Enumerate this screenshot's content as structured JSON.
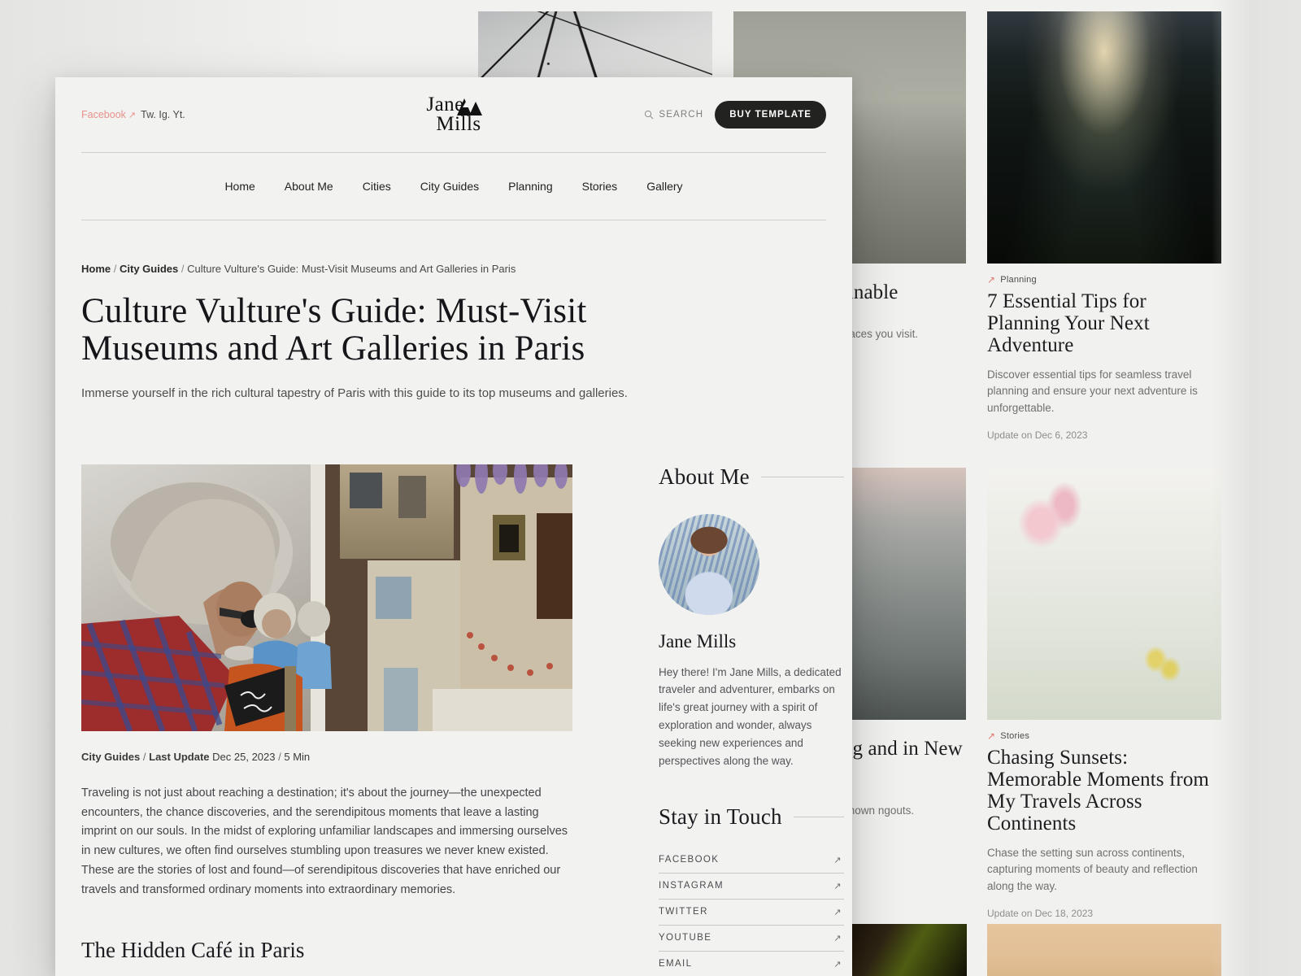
{
  "site": {
    "logo_line1": "Jane",
    "logo_line2": "Mills",
    "logo_mark": "mountain-logo-icon"
  },
  "topbar": {
    "facebook_label": "Facebook",
    "facebook_arrow": "↗",
    "other_socials": "Tw. Ig. Yt.",
    "search_label": "SEARCH",
    "search_icon": "search-icon",
    "buy_label": "BUY TEMPLATE"
  },
  "nav": {
    "items": [
      {
        "label": "Home"
      },
      {
        "label": "About Me"
      },
      {
        "label": "Cities"
      },
      {
        "label": "City Guides"
      },
      {
        "label": "Planning"
      },
      {
        "label": "Stories"
      },
      {
        "label": "Gallery"
      }
    ]
  },
  "breadcrumb": {
    "home": "Home",
    "sep": "/",
    "section": "City Guides",
    "current": "Culture Vulture's Guide: Must-Visit Museums and Art Galleries in Paris"
  },
  "article": {
    "title": "Culture Vulture's Guide: Must-Visit Museums and Art Galleries in Paris",
    "subtitle": "Immerse yourself in the rich cultural tapestry of Paris with this guide to its top museums and galleries.",
    "meta_category": "City Guides",
    "meta_sep1": "/",
    "meta_update_label": "Last Update",
    "meta_date": "Dec 25, 2023",
    "meta_sep2": "/",
    "meta_readtime": "5 Min",
    "body": "Traveling is not just about reaching a destination; it's about the journey—the unexpected encounters, the chance discoveries, and the serendipitous moments that leave a lasting imprint on our souls. In the midst of exploring unfamiliar landscapes and immersing ourselves in new cultures, we often find ourselves stumbling upon treasures we never knew existed. These are the stories of lost and found—of serendipitous discoveries that have enriched our travels and transformed ordinary moments into extraordinary memories.",
    "section_heading": "The Hidden Café in Paris",
    "hero_image": "paris-art-market-photo"
  },
  "sidebar": {
    "about_heading": "About Me",
    "avatar": "jane-mills-avatar",
    "name": "Jane Mills",
    "bio": "Hey there! I'm Jane Mills, a dedicated traveler and adventurer, embarks on life's great journey with a spirit of exploration and wonder, always seeking new experiences and perspectives along the way.",
    "touch_heading": "Stay in Touch",
    "touch_links": [
      {
        "label": "FACEBOOK",
        "arrow": "↗"
      },
      {
        "label": "INSTAGRAM",
        "arrow": "↗"
      },
      {
        "label": "TWITTER",
        "arrow": "↗"
      },
      {
        "label": "YOUTUBE",
        "arrow": "↗"
      },
      {
        "label": "EMAIL",
        "arrow": "↗"
      }
    ]
  },
  "background_cards": [
    {
      "id": "sustainable-travel",
      "category": "",
      "arrow": "",
      "title": "Tips for Sustainable",
      "desc": "sustainably, leaving a places you visit.",
      "date": "",
      "image": "foggy-coast-photo"
    },
    {
      "id": "planning-tips",
      "category": "Planning",
      "arrow": "↗",
      "title": "7 Essential Tips for Planning Your Next Adventure",
      "desc": "Discover essential tips for seamless travel planning and ensure your next adventure is unforgettable.",
      "date": "Update on Dec 6, 2023",
      "image": "suspension-bridge-hiker-photo"
    },
    {
      "id": "new-york-path",
      "category": "",
      "arrow": "",
      "title": "Path: Exploring and in New York",
      "desc": "ure of New York City r-known ngouts.",
      "date": "",
      "image": "new-york-aerial-photo"
    },
    {
      "id": "chasing-sunsets",
      "category": "Stories",
      "arrow": "↗",
      "title": "Chasing Sunsets: Memorable Moments from My Travels Across Continents",
      "desc": "Chase the setting sun across continents, capturing moments of beauty and reflection along the way.",
      "date": "Update on Dec 18, 2023",
      "image": "flower-vases-photo"
    }
  ],
  "colors": {
    "page_bg": "#f1f1ef",
    "window_bg": "#f2f2f0",
    "accent_pink": "#e8918b",
    "button_dark": "#222221",
    "rule": "#cfcfcb"
  }
}
